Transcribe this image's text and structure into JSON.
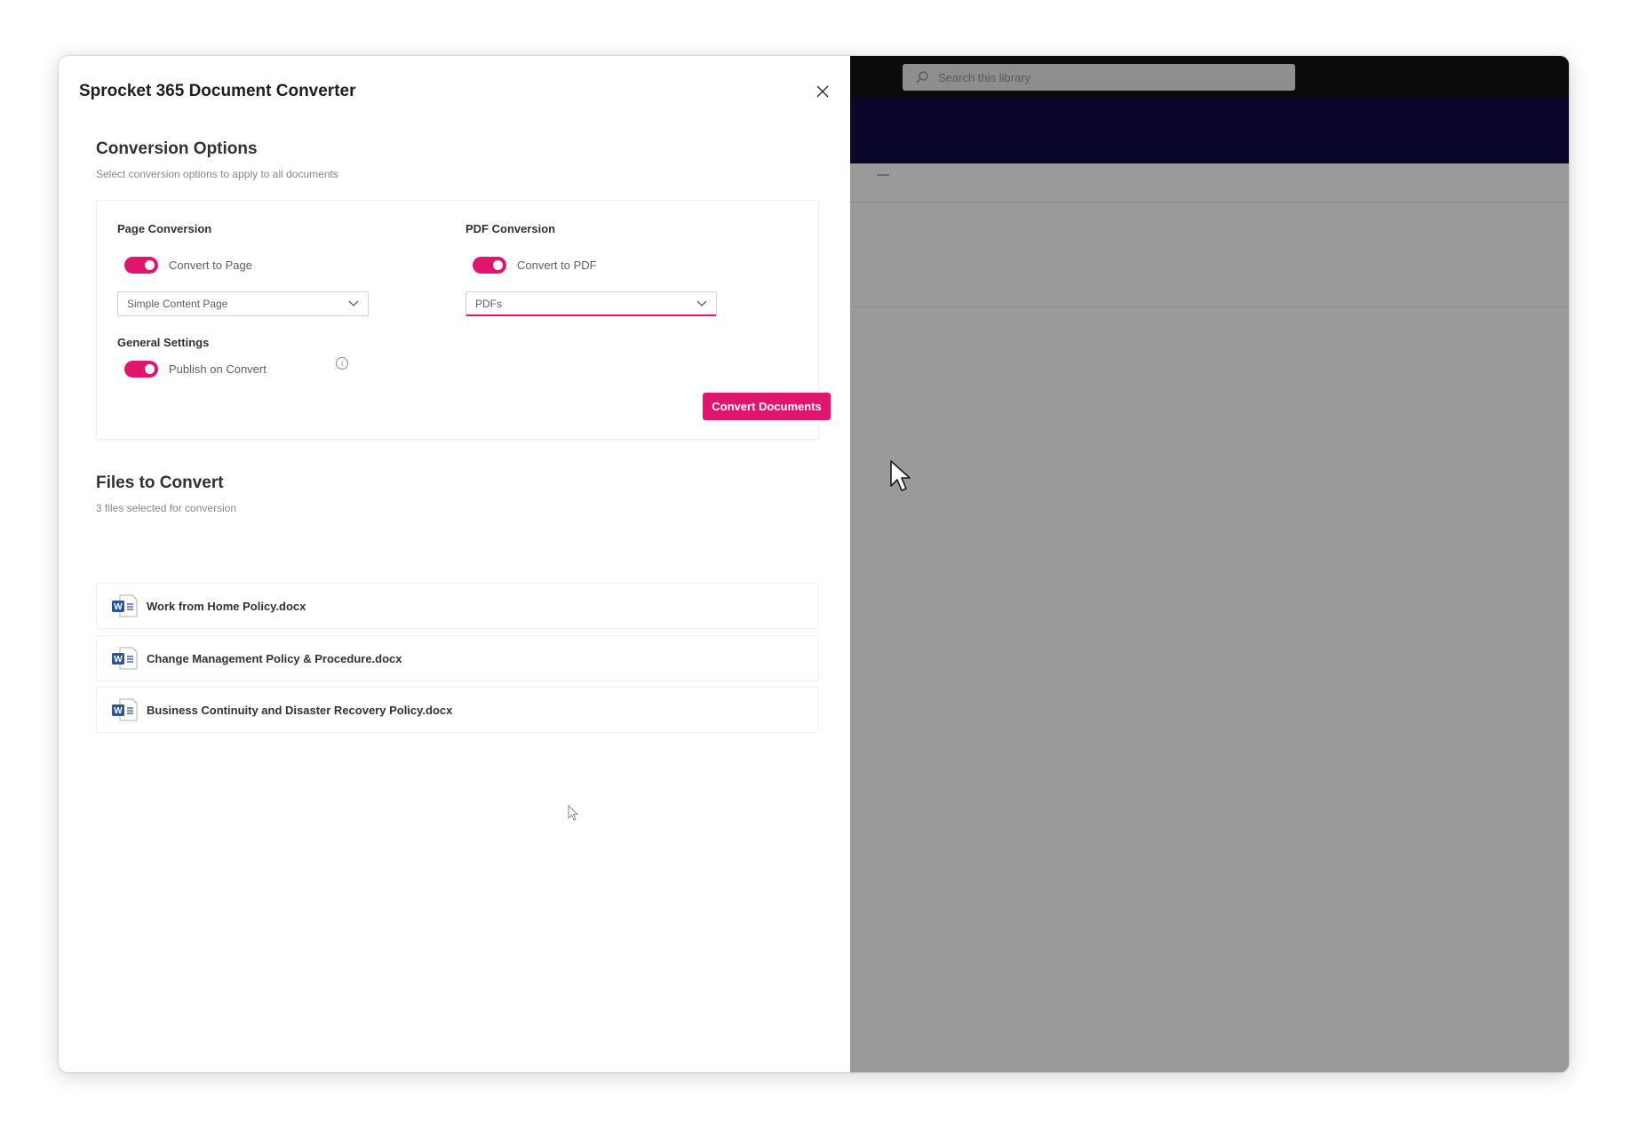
{
  "panel": {
    "title": "Sprocket 365 Document Converter",
    "close_icon": "close-icon"
  },
  "conversion_options": {
    "title": "Conversion Options",
    "subtitle": "Select conversion options to apply to all documents",
    "page_conversion": {
      "label": "Page Conversion",
      "toggle_label": "Convert to Page",
      "toggle_on": true,
      "dropdown_value": "Simple Content Page"
    },
    "pdf_conversion": {
      "label": "PDF Conversion",
      "toggle_label": "Convert to PDF",
      "toggle_on": true,
      "dropdown_value": "PDFs"
    },
    "general_settings": {
      "label": "General Settings",
      "toggle_label": "Publish on Convert",
      "toggle_on": true,
      "info_icon": "info-icon"
    },
    "convert_button": "Convert Documents"
  },
  "files": {
    "title": "Files to Convert",
    "subtitle": "3 files selected for conversion",
    "items": [
      {
        "name": "Work from Home Policy.docx",
        "icon": "word-doc-icon"
      },
      {
        "name": "Change Management Policy & Procedure.docx",
        "icon": "word-doc-icon"
      },
      {
        "name": "Business Continuity and Disaster Recovery Policy.docx",
        "icon": "word-doc-icon"
      }
    ]
  },
  "background": {
    "search_placeholder": "Search this library"
  },
  "colors": {
    "accent": "#e0156f",
    "overlay": "#9a9a9a",
    "site_header": "#0a072a"
  }
}
